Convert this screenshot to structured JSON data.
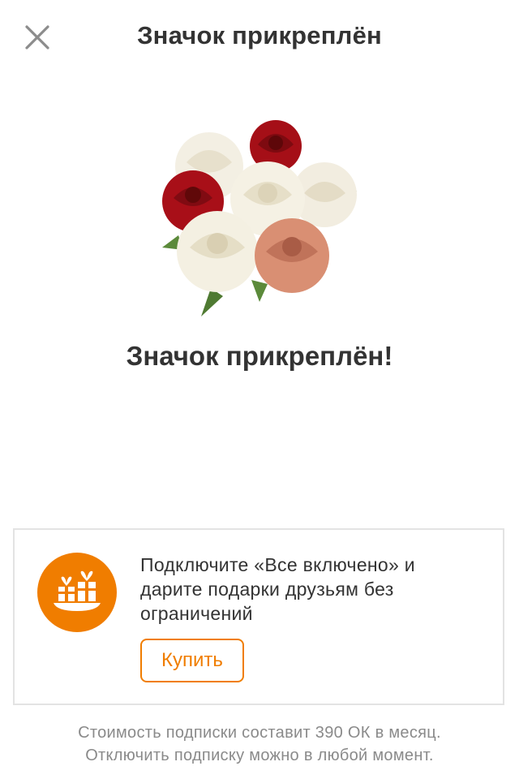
{
  "header": {
    "title": "Значок прикреплён"
  },
  "illustration": {
    "icon": "rose-bouquet-icon"
  },
  "main": {
    "success_title": "Значок прикреплён!"
  },
  "promo": {
    "icon": "gift-icon",
    "text": "Подключите «Все включено» и дарите подарки друзьям без ограничений",
    "buy_label": "Купить"
  },
  "footer": {
    "line1": "Стоимость подписки составит 390 ОК в месяц.",
    "line2": "Отключить подписку можно в любой момент."
  },
  "colors": {
    "accent": "#f07d00",
    "card_border": "#e3e3e3",
    "footnote": "#8a8a8a"
  }
}
